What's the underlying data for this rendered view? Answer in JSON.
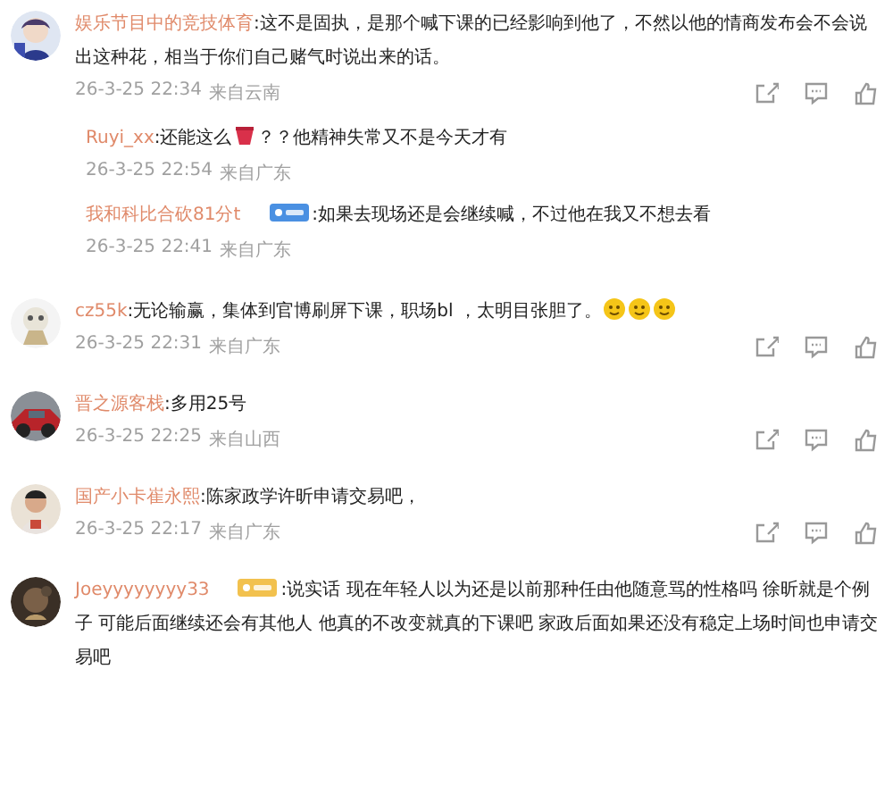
{
  "comments": [
    {
      "author": "娱乐节目中的竞技体育",
      "parts": [
        {
          "kind": "text",
          "text": ":这不是固执，是那个喊下课的已经影响到他了，不然以他的情商发布会不会说出这种花，相当于你们自己赌气时说出来的话。"
        }
      ],
      "time": "26-3-25 22:34",
      "source": "来自云南",
      "show_actions": true,
      "replies": [
        {
          "author": "Ruyi_xx",
          "parts": [
            {
              "kind": "text",
              "text": ":还能这么"
            },
            {
              "kind": "emoji"
            },
            {
              "kind": "text",
              "text": "？？他精神失常又不是今天才有"
            }
          ],
          "time": "26-3-25 22:54",
          "source": "来自广东"
        },
        {
          "author": "我和科比合砍81分t",
          "badge": {
            "color": "#4a90e2"
          },
          "parts": [
            {
              "kind": "text",
              "text": ":如果去现场还是会继续喊，不过他在我又不想去看"
            }
          ],
          "time": "26-3-25 22:41",
          "source": "来自广东"
        }
      ]
    },
    {
      "author": "cz55k",
      "parts": [
        {
          "kind": "text",
          "text": ":无论输赢，集体到官博刷屏下课，职场bl ，太明目张胆了。"
        },
        {
          "kind": "smiley"
        },
        {
          "kind": "smiley"
        },
        {
          "kind": "smiley"
        }
      ],
      "time": "26-3-25 22:31",
      "source": "来自广东",
      "show_actions": true
    },
    {
      "author": "晋之源客栈",
      "parts": [
        {
          "kind": "text",
          "text": ":多用25号"
        }
      ],
      "time": "26-3-25 22:25",
      "source": "来自山西",
      "show_actions": true
    },
    {
      "author": "国产小卡崔永熙",
      "parts": [
        {
          "kind": "text",
          "text": ":陈家政学许昕申请交易吧，"
        }
      ],
      "time": "26-3-25 22:17",
      "source": "来自广东",
      "show_actions": true
    },
    {
      "author": "Joeyyyyyyyy33",
      "badge": {
        "color": "#f2c14e"
      },
      "parts": [
        {
          "kind": "text",
          "text": ":说实话 现在年轻人以为还是以前那种任由他随意骂的性格吗 徐昕就是个例子 可能后面继续还会有其他人 他真的不改变就真的下课吧 家政后面如果还没有稳定上场时间也申请交易吧"
        }
      ],
      "show_actions": false
    }
  ]
}
